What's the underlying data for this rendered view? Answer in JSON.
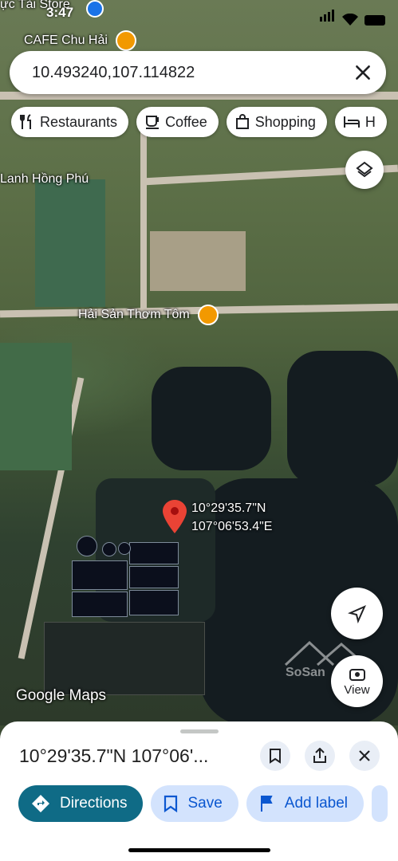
{
  "status": {
    "time": "3:47",
    "top_partial_label": "ực Tài Store"
  },
  "search": {
    "query": "10.493240,107.114822"
  },
  "chips": [
    {
      "label": "Restaurants",
      "icon": "fork-knife-icon"
    },
    {
      "label": "Coffee",
      "icon": "coffee-cup-icon"
    },
    {
      "label": "Shopping",
      "icon": "shopping-bag-icon"
    },
    {
      "label": "H",
      "icon": "bed-icon"
    }
  ],
  "map": {
    "places": {
      "cafe": "CAFE Chu Hải",
      "district": "Lanh Hồng Phú",
      "seafood": "Hải Sản Thơm Tôm"
    },
    "pin": {
      "lat": "10°29'35.7\"N",
      "lng": "107°06'53.4\"E"
    },
    "brand": "Google Maps",
    "watermark": "SoSan",
    "view_label": "View"
  },
  "sheet": {
    "title": "10°29'35.7\"N 107°06'...",
    "actions": {
      "directions": "Directions",
      "save": "Save",
      "add_label": "Add label"
    }
  },
  "colors": {
    "primary_action": "#0f6b86",
    "secondary_action": "#d3e3fd",
    "pin": "#ea4335",
    "poi": "#f29900"
  }
}
